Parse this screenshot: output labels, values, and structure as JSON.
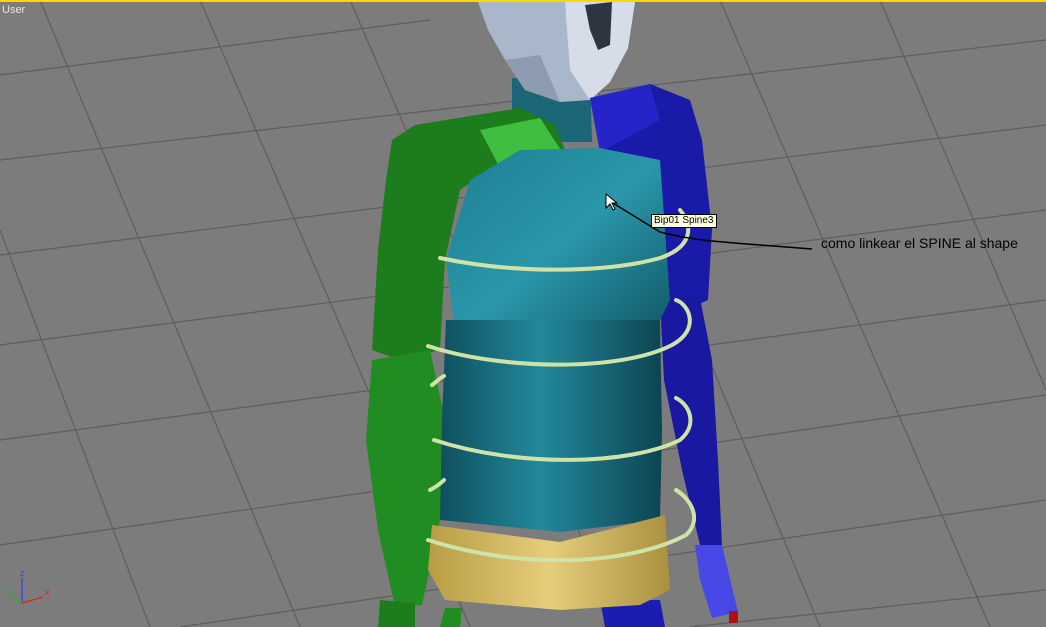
{
  "viewport": {
    "label": "User",
    "active_border_color": "#ffd800",
    "background_color": "#7c7c7c"
  },
  "tooltip": {
    "text": "Bip01 Spine3"
  },
  "annotation": {
    "text": "como linkear el SPINE al shape"
  },
  "axis_gizmo": {
    "x_label": "x",
    "y_label": "y",
    "z_label": "z"
  },
  "icons": {
    "mouse_cursor": "arrow-cursor-icon",
    "axis_gizmo": "axis-tripod-icon"
  },
  "colors": {
    "left_arm": "#1f8a1f",
    "right_arm": "#1a1ab0",
    "torso": "#1c6f7e",
    "pelvis": "#d9c169",
    "head": "#b8c2d4",
    "spring": "#cfe3a8"
  }
}
